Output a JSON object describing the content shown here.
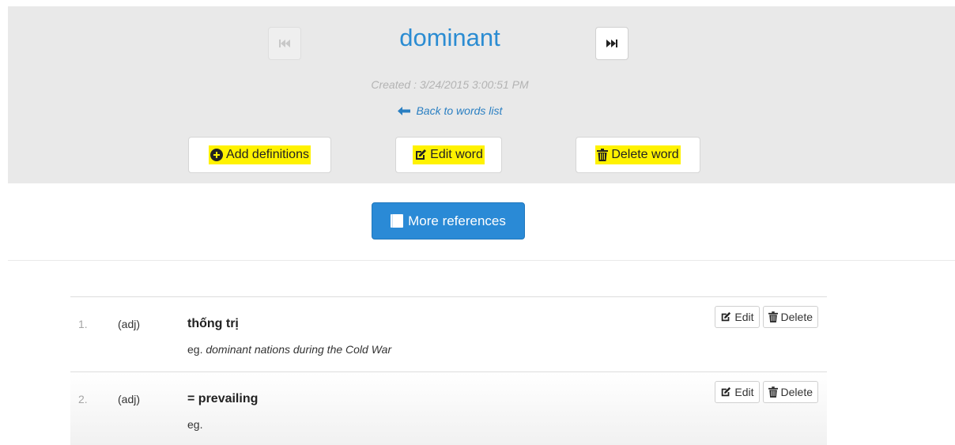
{
  "word": {
    "title": "dominant",
    "created": "Created : 3/24/2015 3:00:51 PM",
    "back_link": "Back to words list"
  },
  "actions": {
    "add_definitions": "Add definitions",
    "edit_word": "Edit word",
    "delete_word": "Delete word",
    "more_references": "More references"
  },
  "icons": {
    "prev": "skip-backward-icon",
    "next": "skip-forward-icon",
    "add": "plus-circle-icon",
    "edit": "edit-icon",
    "delete": "trash-icon",
    "back": "arrow-left-icon",
    "book": "book-icon"
  },
  "colors": {
    "accent": "#2b8cd2",
    "primary_button": "#2a8ad6",
    "highlight": "#fff200",
    "header_bg": "#e9e9e9"
  },
  "definitions": [
    {
      "num": "1.",
      "pos": "(adj)",
      "meaning": "thống trị",
      "example_prefix": "eg.",
      "example_text": "dominant nations during the Cold War",
      "edit_label": "Edit",
      "delete_label": "Delete"
    },
    {
      "num": "2.",
      "pos": "(adj)",
      "meaning": "= prevailing",
      "example_prefix": "eg.",
      "example_text": "",
      "edit_label": "Edit",
      "delete_label": "Delete"
    }
  ]
}
